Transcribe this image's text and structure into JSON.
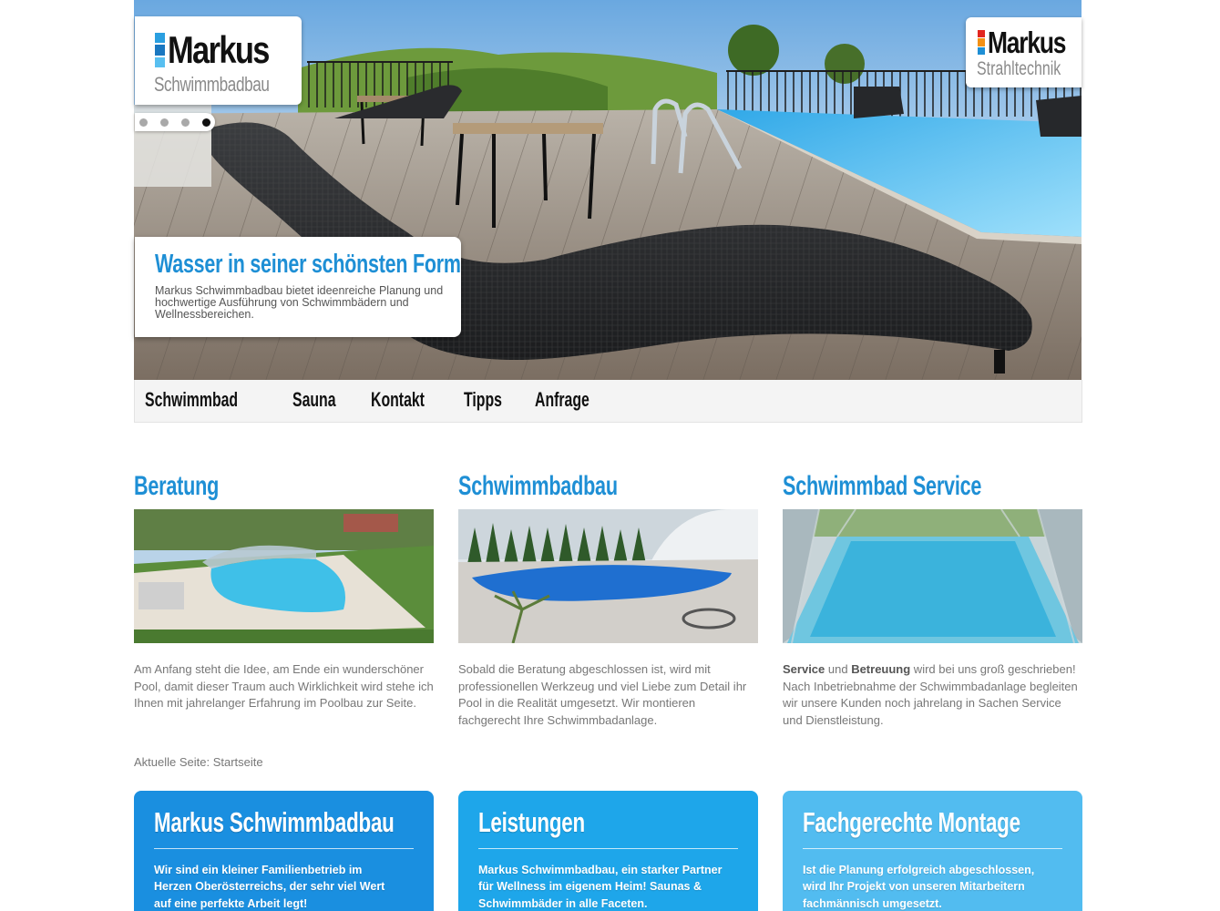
{
  "header": {
    "logo": {
      "name": "Markus",
      "sub": "Schwimmbadbau",
      "bar_colors": [
        "#2a9fe0",
        "#1a77c0",
        "#58bff0"
      ]
    },
    "logo2": {
      "name": "Markus",
      "sub": "Strahltechnik",
      "bar_colors": [
        "#e2261f",
        "#f39014",
        "#1e8fd5"
      ]
    },
    "slider": {
      "slide_count": 4,
      "active_index": 3
    },
    "caption": {
      "title": "Wasser in seiner schönsten Form",
      "text": "Markus Schwimmbadbau bietet ideenreiche Planung und hochwertige Ausführung von Schwimmbädern und Wellnessbereichen."
    }
  },
  "nav": {
    "items": [
      "Schwimmbad",
      "Sauna",
      "Kontakt",
      "Tipps",
      "Anfrage"
    ]
  },
  "features": [
    {
      "title": "Beratung",
      "text": "Am Anfang steht die Idee, am Ende ein wunderschöner Pool, damit dieser Traum auch Wirklichkeit wird stehe ich Ihnen mit jahrelanger Erfahrung im Poolbau zur Seite."
    },
    {
      "title": "Schwimmbadbau",
      "text": "Sobald die Beratung abgeschlossen ist, wird mit professionellen Werkzeug und viel Liebe zum Detail ihr Pool in die Realität umgesetzt. Wir montieren fachgerecht Ihre Schwimmbadanlage."
    },
    {
      "title": "Schwimmbad Service",
      "text_bold_1": "Service",
      "text_mid_1": " und ",
      "text_bold_2": "Betreuung",
      "text_rest": " wird bei uns groß geschrieben! Nach Inbetriebnahme der Schwimmbadanlage begleiten wir unsere Kunden noch jahrelang in Sachen Service und Dienstleistung."
    }
  ],
  "breadcrumb": "Aktuelle Seite: Startseite",
  "boxes": [
    {
      "title": "Markus Schwimmbadbau",
      "text": "Wir sind ein kleiner Familienbetrieb im Herzen Oberösterreichs, der sehr viel Wert auf eine perfekte Arbeit legt!",
      "color": "#1a8fe0"
    },
    {
      "title": "Leistungen",
      "text": "Markus Schwimmbadbau, ein starker Partner für Wellness im eigenem Heim! Saunas & Schwimmbäder in alle Faceten.",
      "color": "#1ea6ea"
    },
    {
      "title": "Fachgerechte Montage",
      "text": "Ist die Planung erfolgreich abgeschlossen, wird Ihr Projekt von unseren Mitarbeitern fachmännisch umgesetzt.",
      "color": "#52bcf0"
    }
  ]
}
